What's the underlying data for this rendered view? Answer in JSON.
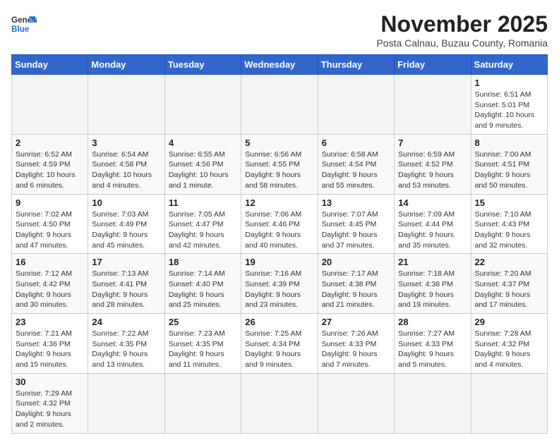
{
  "logo": {
    "line1": "General",
    "line2": "Blue"
  },
  "title": "November 2025",
  "subtitle": "Posta Calnau, Buzau County, Romania",
  "headers": [
    "Sunday",
    "Monday",
    "Tuesday",
    "Wednesday",
    "Thursday",
    "Friday",
    "Saturday"
  ],
  "weeks": [
    [
      {
        "day": "",
        "info": ""
      },
      {
        "day": "",
        "info": ""
      },
      {
        "day": "",
        "info": ""
      },
      {
        "day": "",
        "info": ""
      },
      {
        "day": "",
        "info": ""
      },
      {
        "day": "",
        "info": ""
      },
      {
        "day": "1",
        "info": "Sunrise: 6:51 AM\nSunset: 5:01 PM\nDaylight: 10 hours\nand 9 minutes."
      }
    ],
    [
      {
        "day": "2",
        "info": "Sunrise: 6:52 AM\nSunset: 4:59 PM\nDaylight: 10 hours\nand 6 minutes."
      },
      {
        "day": "3",
        "info": "Sunrise: 6:54 AM\nSunset: 4:58 PM\nDaylight: 10 hours\nand 4 minutes."
      },
      {
        "day": "4",
        "info": "Sunrise: 6:55 AM\nSunset: 4:56 PM\nDaylight: 10 hours\nand 1 minute."
      },
      {
        "day": "5",
        "info": "Sunrise: 6:56 AM\nSunset: 4:55 PM\nDaylight: 9 hours\nand 58 minutes."
      },
      {
        "day": "6",
        "info": "Sunrise: 6:58 AM\nSunset: 4:54 PM\nDaylight: 9 hours\nand 55 minutes."
      },
      {
        "day": "7",
        "info": "Sunrise: 6:59 AM\nSunset: 4:52 PM\nDaylight: 9 hours\nand 53 minutes."
      },
      {
        "day": "8",
        "info": "Sunrise: 7:00 AM\nSunset: 4:51 PM\nDaylight: 9 hours\nand 50 minutes."
      }
    ],
    [
      {
        "day": "9",
        "info": "Sunrise: 7:02 AM\nSunset: 4:50 PM\nDaylight: 9 hours\nand 47 minutes."
      },
      {
        "day": "10",
        "info": "Sunrise: 7:03 AM\nSunset: 4:49 PM\nDaylight: 9 hours\nand 45 minutes."
      },
      {
        "day": "11",
        "info": "Sunrise: 7:05 AM\nSunset: 4:47 PM\nDaylight: 9 hours\nand 42 minutes."
      },
      {
        "day": "12",
        "info": "Sunrise: 7:06 AM\nSunset: 4:46 PM\nDaylight: 9 hours\nand 40 minutes."
      },
      {
        "day": "13",
        "info": "Sunrise: 7:07 AM\nSunset: 4:45 PM\nDaylight: 9 hours\nand 37 minutes."
      },
      {
        "day": "14",
        "info": "Sunrise: 7:09 AM\nSunset: 4:44 PM\nDaylight: 9 hours\nand 35 minutes."
      },
      {
        "day": "15",
        "info": "Sunrise: 7:10 AM\nSunset: 4:43 PM\nDaylight: 9 hours\nand 32 minutes."
      }
    ],
    [
      {
        "day": "16",
        "info": "Sunrise: 7:12 AM\nSunset: 4:42 PM\nDaylight: 9 hours\nand 30 minutes."
      },
      {
        "day": "17",
        "info": "Sunrise: 7:13 AM\nSunset: 4:41 PM\nDaylight: 9 hours\nand 28 minutes."
      },
      {
        "day": "18",
        "info": "Sunrise: 7:14 AM\nSunset: 4:40 PM\nDaylight: 9 hours\nand 25 minutes."
      },
      {
        "day": "19",
        "info": "Sunrise: 7:16 AM\nSunset: 4:39 PM\nDaylight: 9 hours\nand 23 minutes."
      },
      {
        "day": "20",
        "info": "Sunrise: 7:17 AM\nSunset: 4:38 PM\nDaylight: 9 hours\nand 21 minutes."
      },
      {
        "day": "21",
        "info": "Sunrise: 7:18 AM\nSunset: 4:38 PM\nDaylight: 9 hours\nand 19 minutes."
      },
      {
        "day": "22",
        "info": "Sunrise: 7:20 AM\nSunset: 4:37 PM\nDaylight: 9 hours\nand 17 minutes."
      }
    ],
    [
      {
        "day": "23",
        "info": "Sunrise: 7:21 AM\nSunset: 4:36 PM\nDaylight: 9 hours\nand 15 minutes."
      },
      {
        "day": "24",
        "info": "Sunrise: 7:22 AM\nSunset: 4:35 PM\nDaylight: 9 hours\nand 13 minutes."
      },
      {
        "day": "25",
        "info": "Sunrise: 7:23 AM\nSunset: 4:35 PM\nDaylight: 9 hours\nand 11 minutes."
      },
      {
        "day": "26",
        "info": "Sunrise: 7:25 AM\nSunset: 4:34 PM\nDaylight: 9 hours\nand 9 minutes."
      },
      {
        "day": "27",
        "info": "Sunrise: 7:26 AM\nSunset: 4:33 PM\nDaylight: 9 hours\nand 7 minutes."
      },
      {
        "day": "28",
        "info": "Sunrise: 7:27 AM\nSunset: 4:33 PM\nDaylight: 9 hours\nand 5 minutes."
      },
      {
        "day": "29",
        "info": "Sunrise: 7:28 AM\nSunset: 4:32 PM\nDaylight: 9 hours\nand 4 minutes."
      }
    ],
    [
      {
        "day": "30",
        "info": "Sunrise: 7:29 AM\nSunset: 4:32 PM\nDaylight: 9 hours\nand 2 minutes."
      },
      {
        "day": "",
        "info": ""
      },
      {
        "day": "",
        "info": ""
      },
      {
        "day": "",
        "info": ""
      },
      {
        "day": "",
        "info": ""
      },
      {
        "day": "",
        "info": ""
      },
      {
        "day": "",
        "info": ""
      }
    ]
  ]
}
